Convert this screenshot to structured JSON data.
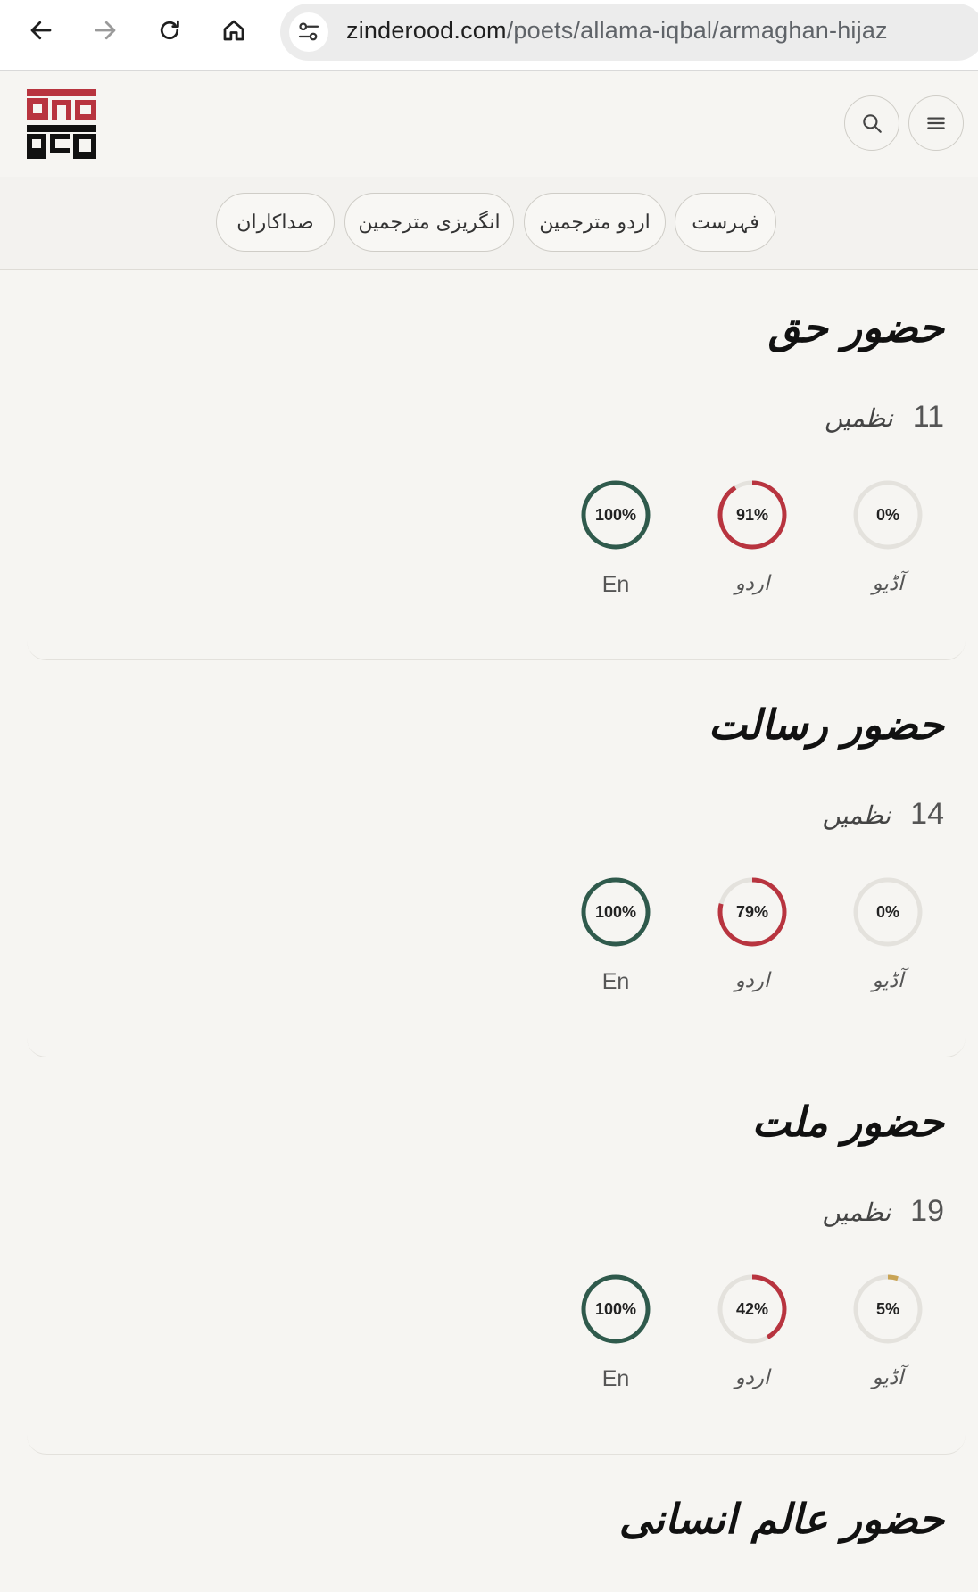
{
  "browser": {
    "url_host": "zinderood.com",
    "url_path": "/poets/allama-iqbal/armaghan-hijaz"
  },
  "tabs": [
    {
      "label": "فہرست"
    },
    {
      "label": "اردو مترجمین"
    },
    {
      "label": "انگریزی مترجمین"
    },
    {
      "label": "صداکاران"
    }
  ],
  "colors": {
    "en": "#2f5a4c",
    "urdu": "#b8343f",
    "audio": "#c9a455",
    "track": "#e4e2dd"
  },
  "sections": [
    {
      "title": "حضور حق",
      "count": "11",
      "count_label": "نظمیں",
      "stats": [
        {
          "key": "en",
          "label": "En",
          "percent": 100,
          "text": "100%"
        },
        {
          "key": "urdu",
          "label": "اردو",
          "percent": 91,
          "text": "91%"
        },
        {
          "key": "audio",
          "label": "آڈیو",
          "percent": 0,
          "text": "0%"
        }
      ]
    },
    {
      "title": "حضور رسالت",
      "count": "14",
      "count_label": "نظمیں",
      "stats": [
        {
          "key": "en",
          "label": "En",
          "percent": 100,
          "text": "100%"
        },
        {
          "key": "urdu",
          "label": "اردو",
          "percent": 79,
          "text": "79%"
        },
        {
          "key": "audio",
          "label": "آڈیو",
          "percent": 0,
          "text": "0%"
        }
      ]
    },
    {
      "title": "حضور ملت",
      "count": "19",
      "count_label": "نظمیں",
      "stats": [
        {
          "key": "en",
          "label": "En",
          "percent": 100,
          "text": "100%"
        },
        {
          "key": "urdu",
          "label": "اردو",
          "percent": 42,
          "text": "42%"
        },
        {
          "key": "audio",
          "label": "آڈیو",
          "percent": 5,
          "text": "5%"
        }
      ]
    },
    {
      "title": "حضور عالم انسانی"
    }
  ]
}
